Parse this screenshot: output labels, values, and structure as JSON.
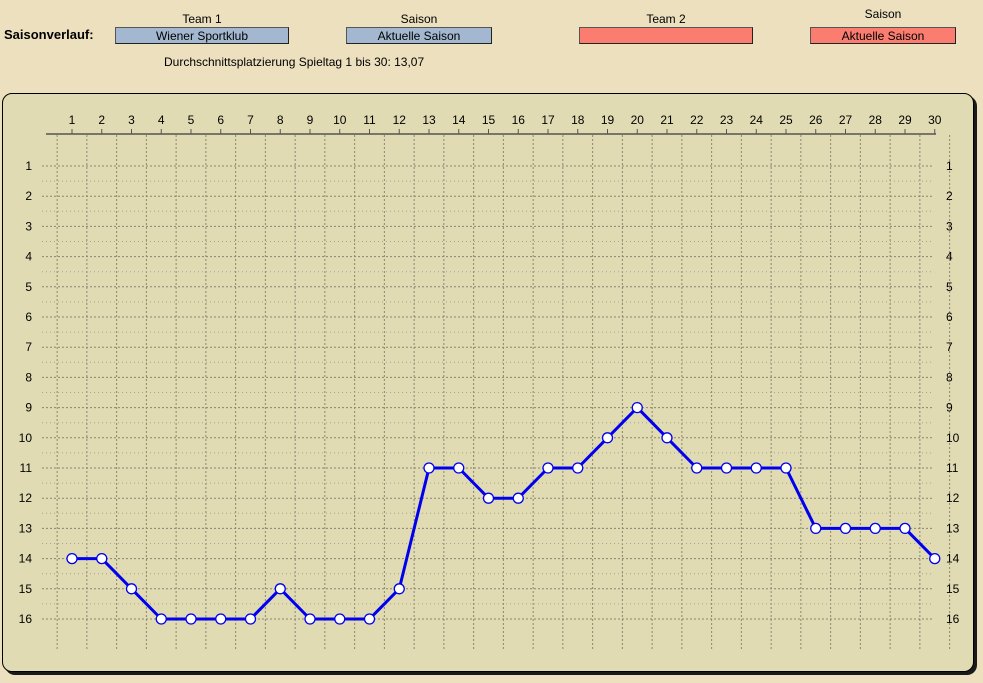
{
  "header": {
    "label": "Saisonverlauf:",
    "team1_title": "Team 1",
    "team1_value": "Wiener Sportklub",
    "season1_title": "Saison",
    "season1_value": "Aktuelle Saison",
    "team2_title": "Team 2",
    "team2_value": "",
    "season2_title": "Saison",
    "season2_value": "Aktuelle Saison",
    "average_text": "Durchschnittsplatzierung Spieltag 1 bis 30: 13,07"
  },
  "colors": {
    "team1": "#a3b8d0",
    "team2": "#fb7d70",
    "line": "#0000ee",
    "background": "#ece0bf",
    "panel": "#e1dbb3"
  },
  "chart_data": {
    "type": "line",
    "x": [
      1,
      2,
      3,
      4,
      5,
      6,
      7,
      8,
      9,
      10,
      11,
      12,
      13,
      14,
      15,
      16,
      17,
      18,
      19,
      20,
      21,
      22,
      23,
      24,
      25,
      26,
      27,
      28,
      29,
      30
    ],
    "series": [
      {
        "values": [
          14,
          14,
          15,
          16,
          16,
          16,
          16,
          15,
          16,
          16,
          16,
          15,
          11,
          11,
          12,
          12,
          11,
          11,
          10,
          9,
          10,
          11,
          11,
          11,
          11,
          13,
          13,
          13,
          13,
          14
        ]
      }
    ],
    "xlim": [
      1,
      30
    ],
    "ylim": [
      1,
      16
    ],
    "y_inverted": true,
    "grid": true,
    "x_ticks": [
      "1",
      "2",
      "3",
      "4",
      "5",
      "6",
      "7",
      "8",
      "9",
      "10",
      "11",
      "12",
      "13",
      "14",
      "15",
      "16",
      "17",
      "18",
      "19",
      "20",
      "21",
      "22",
      "23",
      "24",
      "25",
      "26",
      "27",
      "28",
      "29",
      "30"
    ],
    "y_ticks": [
      "1",
      "2",
      "3",
      "4",
      "5",
      "6",
      "7",
      "8",
      "9",
      "10",
      "11",
      "12",
      "13",
      "14",
      "15",
      "16"
    ]
  }
}
